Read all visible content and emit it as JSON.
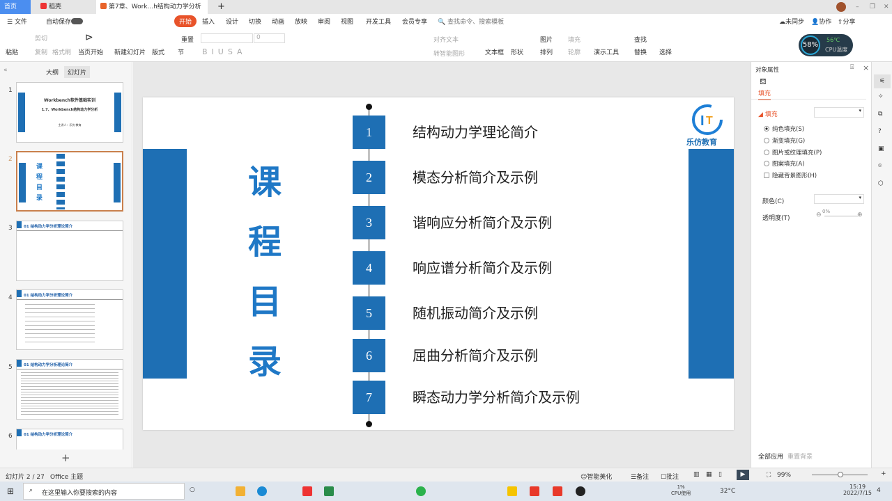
{
  "tabs": [
    {
      "label": "首页"
    },
    {
      "label": "稻壳"
    },
    {
      "label": "第7章、Work...h结构动力学分析"
    }
  ],
  "menu": {
    "file": "文件",
    "autosave": "自动保存",
    "items": [
      "开始",
      "插入",
      "设计",
      "切换",
      "动画",
      "放映",
      "审阅",
      "视图",
      "开发工具",
      "会员专享"
    ],
    "search": "查找命令、搜索模板",
    "sync": "未同步",
    "collab": "协作",
    "share": "分享"
  },
  "ribbon": {
    "paste": "粘贴",
    "cut": "剪切",
    "copy": "复制",
    "format_painter": "格式刷",
    "play": "当页开始",
    "new_slide": "新建幻灯片",
    "layout": "版式",
    "section": "节",
    "reset": "重置",
    "font_size": "0",
    "align_text": "对齐文本",
    "smart_shape": "转智能图形",
    "textbox": "文本框",
    "shape": "形状",
    "picture": "图片",
    "arrange": "排列",
    "fill": "填充",
    "outline": "轮廓",
    "present_tools": "演示工具",
    "find": "查找",
    "replace": "替换",
    "select": "选择"
  },
  "cpu_widget": {
    "percent": "58%",
    "temp": "56℃",
    "label": "CPU温度"
  },
  "left_panel": {
    "tab_outline": "大纲",
    "tab_slides": "幻灯片",
    "slides": [
      {
        "num": "1",
        "title": "Workbench软件基础实训",
        "subtitle": "1.7、Workbench结构动力学分析",
        "presenter": "主讲人：乐仿·教育"
      },
      {
        "num": "2"
      },
      {
        "num": "3",
        "title": "01  结构动力学分析理论简介"
      },
      {
        "num": "4",
        "title": "01  结构动力学分析理论简介"
      },
      {
        "num": "5",
        "title": "01  结构动力学分析理论简介"
      },
      {
        "num": "6",
        "title": "01  结构动力学分析理论简介"
      }
    ]
  },
  "slide": {
    "heading_chars": [
      "课",
      "程",
      "目",
      "录"
    ],
    "logo_text": "乐仿教育",
    "items": [
      {
        "n": "1",
        "text": "结构动力学理论简介"
      },
      {
        "n": "2",
        "text": "模态分析简介及示例"
      },
      {
        "n": "3",
        "text": "谐响应分析简介及示例"
      },
      {
        "n": "4",
        "text": "响应谱分析简介及示例"
      },
      {
        "n": "5",
        "text": "随机振动简介及示例"
      },
      {
        "n": "6",
        "text": "屈曲分析简介及示例"
      },
      {
        "n": "7",
        "text": "瞬态动力学分析简介及示例"
      }
    ]
  },
  "right_panel": {
    "title": "对象属性",
    "tab": "填充",
    "section": "填充",
    "options": [
      "纯色填充(S)",
      "渐变填充(G)",
      "图片或纹理填充(P)",
      "图案填充(A)"
    ],
    "hide_bg": "隐藏背景图形(H)",
    "color_label": "颜色(C)",
    "transparency_label": "透明度(T)",
    "transparency": "0%",
    "apply_all": "全部应用",
    "reset_bg": "重置背景"
  },
  "status": {
    "slide_info": "幻灯片 2 / 27",
    "theme": "Office 主题",
    "beautify": "智能美化",
    "notes": "备注",
    "comments": "批注",
    "zoom": "99%"
  },
  "taskbar": {
    "search_placeholder": "在这里输入你要搜索的内容",
    "cpu": "1%",
    "cpu_label": "CPU使用",
    "weather": "32°C",
    "time": "15:19",
    "date": "2022/7/15",
    "notif": "4"
  },
  "colors": {
    "accent": "#1e6fb4",
    "heading": "#1f78c6",
    "active_tab": "#e8532a"
  }
}
